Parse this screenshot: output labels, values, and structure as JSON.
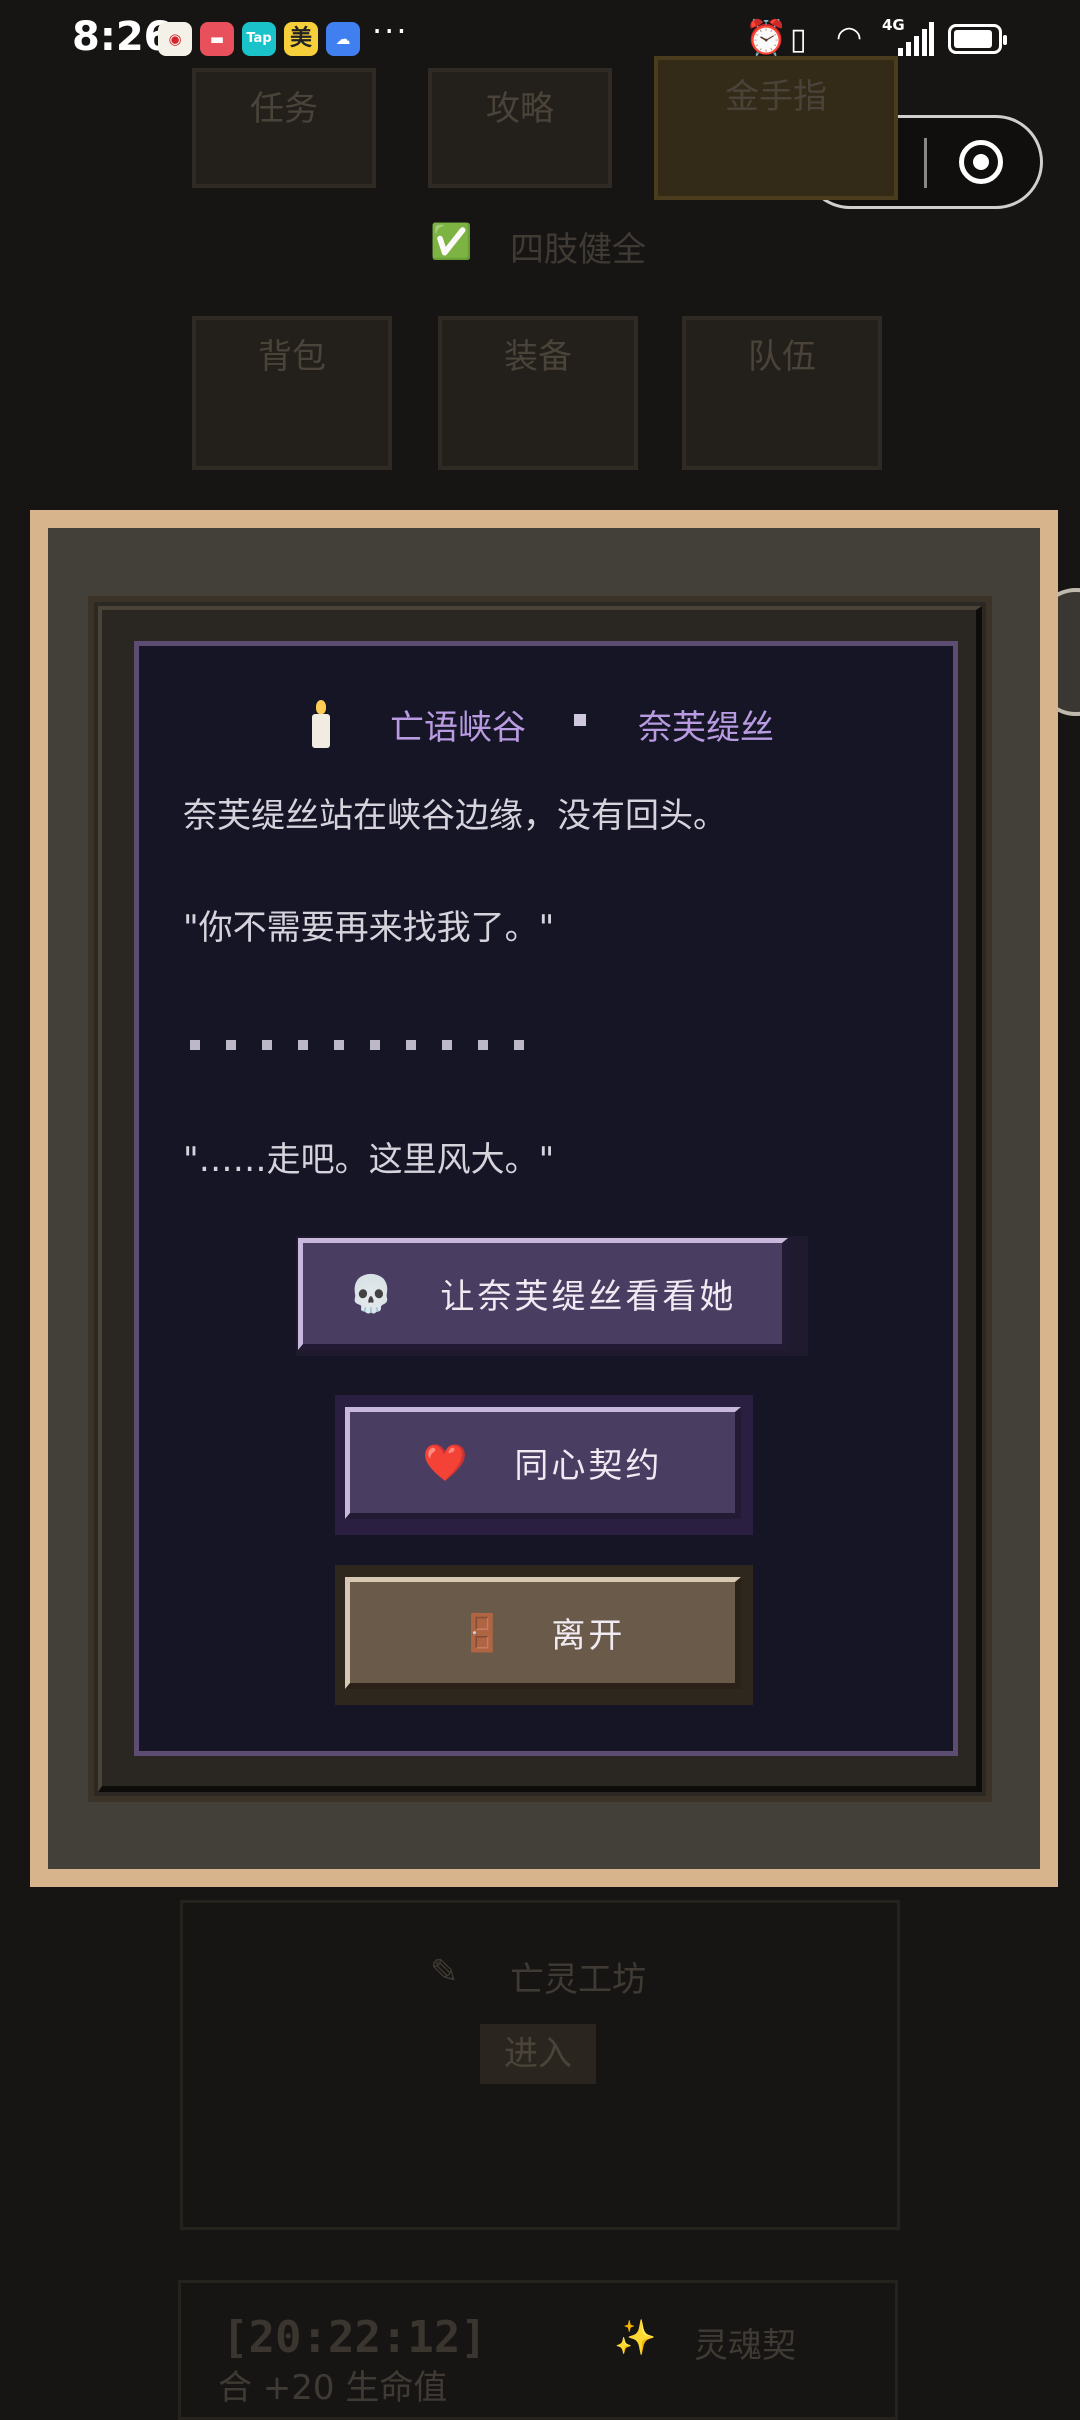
{
  "status_bar": {
    "time": "8:26",
    "more": "···",
    "network": "4G",
    "notification_icons": [
      "weibo-icon",
      "red-app-icon",
      "taptap-icon",
      "meituan-icon",
      "weather-icon"
    ],
    "notif_labels": [
      "",
      "",
      "Tap",
      "美",
      ""
    ]
  },
  "background": {
    "top_tiles": [
      "任务",
      "攻略",
      "金手指"
    ],
    "checkbox_label": "四肢健全",
    "middle_tiles": [
      "背包",
      "装备",
      "队伍"
    ],
    "workshop_label": "亡灵工坊",
    "enter_button": "进入",
    "log_time": "[20:22:12]",
    "log_event": "灵魂契",
    "log_line2": "合  +20  生命值"
  },
  "dialog": {
    "location": "亡语峡谷",
    "npc": "奈芙缇丝",
    "lines": [
      "奈芙缇丝站在峡谷边缘，没有回头。",
      "\"你不需要再来找我了。\"",
      "\"……走吧。这里风大。\""
    ],
    "choices": [
      {
        "icon": "💀",
        "label": "让奈芙缇丝看看她"
      },
      {
        "icon": "❤️",
        "label": "同心契约"
      },
      {
        "icon": "🚪",
        "label": "离开"
      }
    ]
  },
  "colors": {
    "frame": "#d7b48c",
    "dialog_bg": "#151526",
    "dialog_border": "#5d4d73",
    "title": "#b89be0",
    "choice_purple": "#4a3d62",
    "choice_brown": "#6a5a49"
  }
}
